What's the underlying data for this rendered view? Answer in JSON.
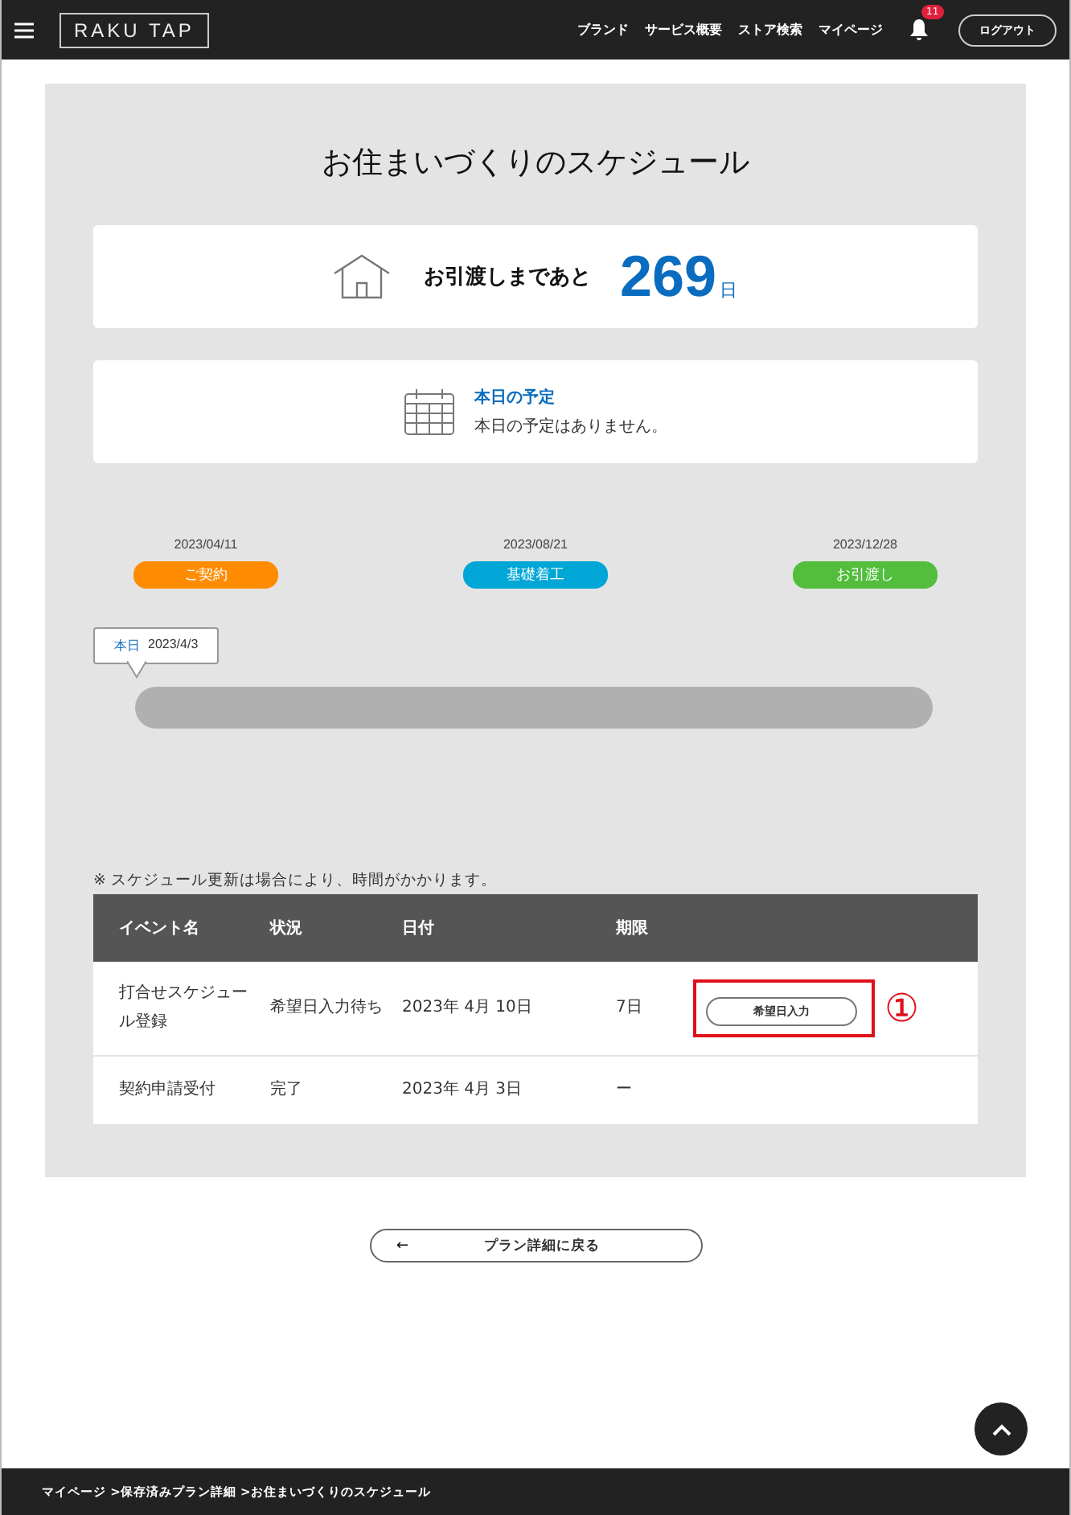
{
  "header": {
    "logo": "RAKU TAP",
    "nav": [
      "ブランド",
      "サービス概要",
      "ストア検索",
      "マイページ"
    ],
    "notification_count": "11",
    "logout": "ログアウト"
  },
  "title": "お住まいづくりのスケジュール",
  "countdown": {
    "label": "お引渡しまであと",
    "days": "269",
    "unit": "日"
  },
  "today_schedule": {
    "heading": "本日の予定",
    "text": "本日の予定はありません。"
  },
  "timeline": {
    "milestones": [
      {
        "date": "2023/04/11",
        "label": "ご契約",
        "color": "#ff8c00"
      },
      {
        "date": "2023/08/21",
        "label": "基礎着工",
        "color": "#00a6d6"
      },
      {
        "date": "2023/12/28",
        "label": "お引渡し",
        "color": "#52be3c"
      }
    ],
    "today_label": "本日",
    "today_date": "2023/4/3"
  },
  "note": "※ スケジュール更新は場合により、時間がかかります。",
  "table": {
    "columns": [
      "イベント名",
      "状況",
      "日付",
      "期限"
    ],
    "rows": [
      {
        "event": "打合せスケジュール登録",
        "status": "希望日入力待ち",
        "date": "2023年 4月 10日",
        "deadline": "7日",
        "action": "希望日入力",
        "annotation": "①"
      },
      {
        "event": "契約申請受付",
        "status": "完了",
        "date": "2023年 4月 3日",
        "deadline": "ー"
      }
    ]
  },
  "back_button": {
    "arrow": "←",
    "label": "プラン詳細に戻る"
  },
  "breadcrumb": "マイページ >保存済みプラン詳細 >お住まいづくりのスケジュール"
}
